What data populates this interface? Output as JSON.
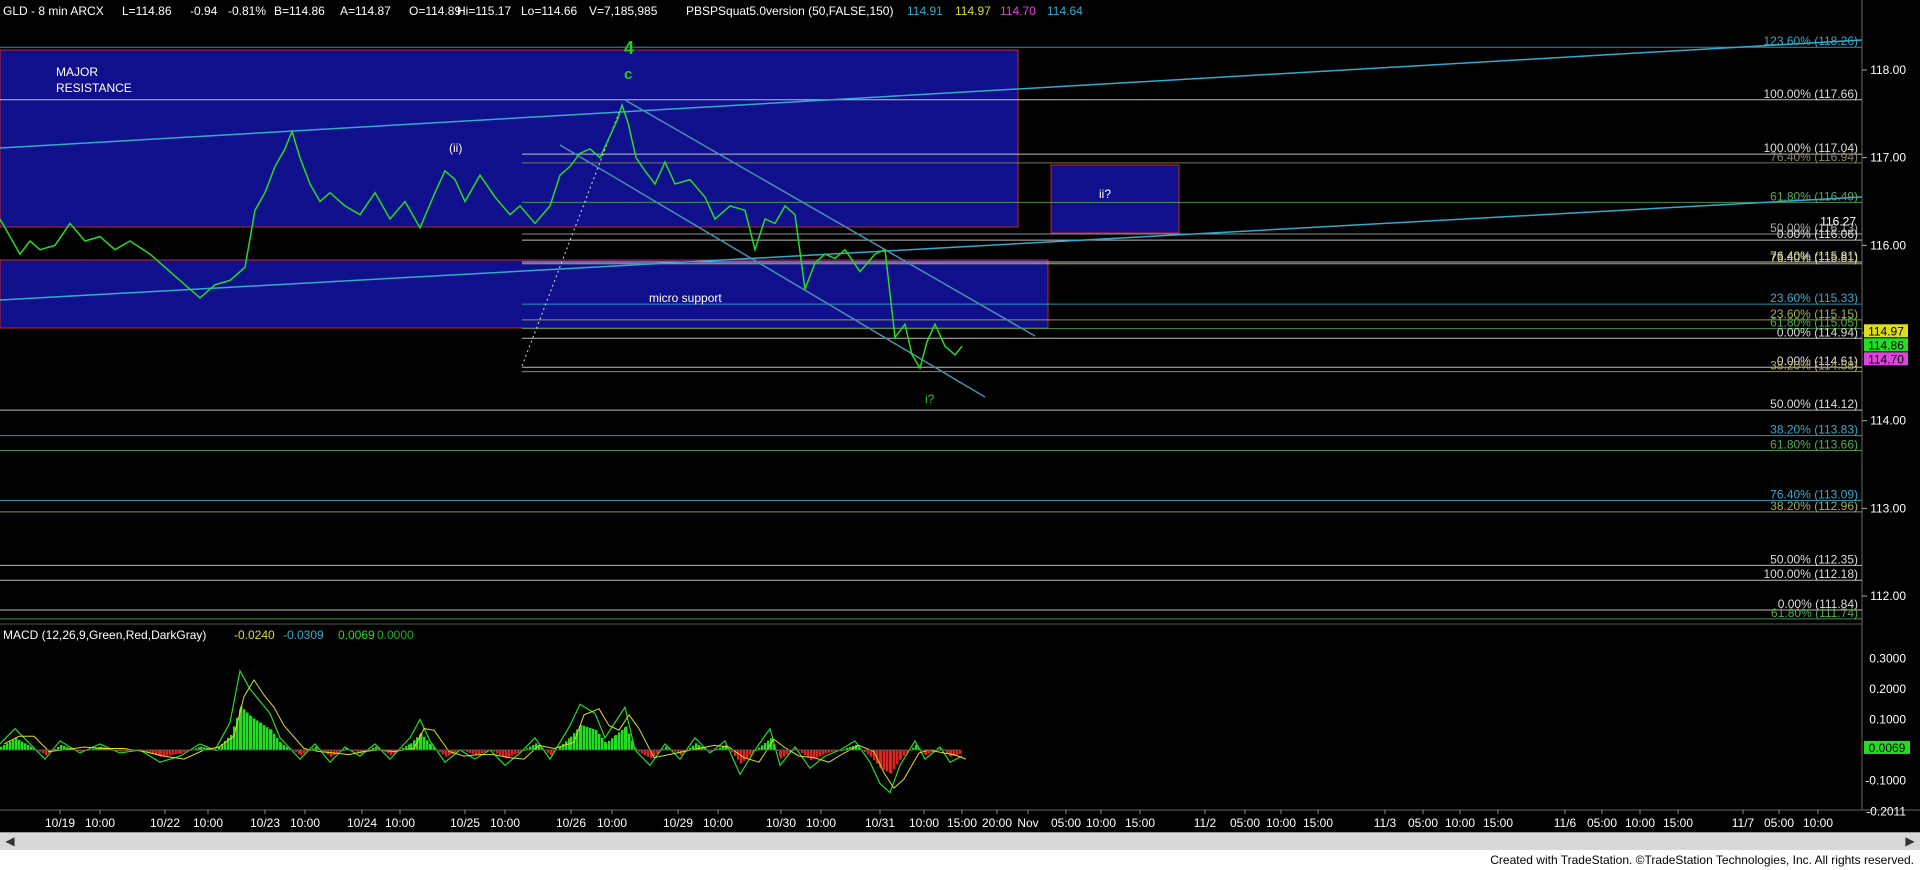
{
  "header": {
    "symbol": "GLD - 8 min  ARCX",
    "last": "L=114.86",
    "change": "-0.94",
    "pct": "-0.81%",
    "bid": "B=114.86",
    "ask": "A=114.87",
    "open": "O=114.89",
    "high": "Hi=115.17",
    "low": "Lo=114.66",
    "volume": "V=7,185,985",
    "study": "PBSPSquat5.0version (50,FALSE,150)",
    "v1": "114.91",
    "v2": "114.97",
    "v3": "114.70",
    "v4": "114.64"
  },
  "macd_header": {
    "name": "MACD (12,26,9,Green,Red,DarkGray)",
    "v1": "-0.0240",
    "v2": "-0.0309",
    "v3": "0.0069",
    "v4": "0.0000"
  },
  "colors": {
    "price": "#22dd22",
    "cyan": "#33aacc",
    "blue_box": "#10108c",
    "box_border": "#c02828",
    "green_label": "#22cc22",
    "yellow": "#dddd22",
    "magenta": "#dd44dd"
  },
  "annotations": {
    "major_resistance_1": "MAJOR",
    "major_resistance_2": "RESISTANCE",
    "micro_support": "micro support",
    "ii_box": "ii?",
    "wave4": "4",
    "wave_c": "c",
    "wave_ii_small": "(ii)",
    "wave_i": "i?"
  },
  "footer": {
    "credit": "Created with TradeStation. ©TradeStation Technologies, Inc. All rights reserved."
  },
  "chart_data": {
    "type": "line",
    "price_axis": {
      "ticks": [
        "118.00",
        "117.00",
        "116.00",
        "115.00",
        "114.00",
        "113.00",
        "112.00"
      ],
      "ylim": [
        111.6,
        118.6
      ]
    },
    "price_tags": [
      {
        "text": "116.27",
        "bg": "#000000",
        "fg": "#ffffff",
        "y": 116.27
      },
      {
        "text": "114.97",
        "bg": "#dddd22",
        "fg": "#000000",
        "y": 115.02
      },
      {
        "text": "114.86",
        "bg": "#22dd22",
        "fg": "#000000",
        "y": 114.86
      },
      {
        "text": "114.70",
        "bg": "#dd44dd",
        "fg": "#000000",
        "y": 114.7
      }
    ],
    "fib_levels": [
      {
        "text": "123.60% (118.26)",
        "y": 118.26,
        "color": "#33aacc"
      },
      {
        "text": "100.00% (117.66)",
        "y": 117.66,
        "color": "#dddddd"
      },
      {
        "text": "100.00% (117.04)",
        "y": 117.04,
        "color": "#dddddd"
      },
      {
        "text": "76.40% (116.94)",
        "y": 116.94,
        "color": "#888866"
      },
      {
        "text": "61.80% (116.49)",
        "y": 116.49,
        "color": "#55aa55"
      },
      {
        "text": "50.00% (116.13)",
        "y": 116.13,
        "color": "#aaaaaa"
      },
      {
        "text": "0.00% (116.06)",
        "y": 116.06,
        "color": "#dddddd"
      },
      {
        "text": "76.40% (115.81)",
        "y": 115.81,
        "color": "#dddddd"
      },
      {
        "text": "76.40% (115.81)",
        "y": 115.79,
        "color": "#cccc66"
      },
      {
        "text": "23.60% (115.33)",
        "y": 115.33,
        "color": "#33aacc"
      },
      {
        "text": "23.60% (115.15)",
        "y": 115.15,
        "color": "#aaaa55"
      },
      {
        "text": "61.80% (115.05)",
        "y": 115.05,
        "color": "#55aa55"
      },
      {
        "text": "0.00% (114.94)",
        "y": 114.94,
        "color": "#dddddd"
      },
      {
        "text": "0.00% (114.61)",
        "y": 114.61,
        "color": "#dddddd"
      },
      {
        "text": "38.20% (114.58)",
        "y": 114.56,
        "color": "#aaaa55"
      },
      {
        "text": "50.00% (114.12)",
        "y": 114.12,
        "color": "#dddddd"
      },
      {
        "text": "38.20% (113.83)",
        "y": 113.83,
        "color": "#33aacc"
      },
      {
        "text": "61.80% (113.66)",
        "y": 113.66,
        "color": "#55aa55"
      },
      {
        "text": "76.40% (113.09)",
        "y": 113.09,
        "color": "#33aacc"
      },
      {
        "text": "38.20% (112.96)",
        "y": 112.96,
        "color": "#aaaa55"
      },
      {
        "text": "50.00% (112.35)",
        "y": 112.35,
        "color": "#dddddd"
      },
      {
        "text": "100.00% (112.18)",
        "y": 112.18,
        "color": "#dddddd"
      },
      {
        "text": "0.00% (111.84)",
        "y": 111.84,
        "color": "#dddddd"
      },
      {
        "text": "61.80% (111.74)",
        "y": 111.74,
        "color": "#55aa55"
      }
    ],
    "macd_axis": {
      "ticks": [
        "0.3000",
        "0.2000",
        "0.1000",
        "-0.1000",
        "-0.2011"
      ],
      "current": "0.0069"
    },
    "x_labels": [
      "10/19",
      "10:00",
      "10/22",
      "10:00",
      "10/23",
      "10:00",
      "10/24",
      "10:00",
      "10/25",
      "10:00",
      "10/26",
      "10:00",
      "10/29",
      "10:00",
      "10/30",
      "10:00",
      "10/31",
      "10:00",
      "15:00",
      "20:00",
      "Nov",
      "05:00",
      "10:00",
      "15:00",
      "11/2",
      "05:00",
      "10:00",
      "15:00",
      "11/3",
      "05:00",
      "10:00",
      "15:00",
      "11/6",
      "05:00",
      "10:00",
      "15:00",
      "11/7",
      "05:00",
      "10:00"
    ],
    "price_path": [
      [
        0,
        116.3
      ],
      [
        10,
        116.1
      ],
      [
        20,
        115.9
      ],
      [
        30,
        116.05
      ],
      [
        40,
        115.95
      ],
      [
        55,
        116.0
      ],
      [
        70,
        116.25
      ],
      [
        85,
        116.05
      ],
      [
        100,
        116.1
      ],
      [
        115,
        115.95
      ],
      [
        130,
        116.05
      ],
      [
        150,
        115.9
      ],
      [
        165,
        115.75
      ],
      [
        180,
        115.6
      ],
      [
        200,
        115.4
      ],
      [
        215,
        115.55
      ],
      [
        230,
        115.6
      ],
      [
        245,
        115.75
      ],
      [
        255,
        116.4
      ],
      [
        265,
        116.6
      ],
      [
        275,
        116.9
      ],
      [
        285,
        117.1
      ],
      [
        292,
        117.3
      ],
      [
        300,
        117.0
      ],
      [
        310,
        116.7
      ],
      [
        320,
        116.5
      ],
      [
        330,
        116.6
      ],
      [
        345,
        116.45
      ],
      [
        360,
        116.35
      ],
      [
        375,
        116.6
      ],
      [
        390,
        116.3
      ],
      [
        405,
        116.5
      ],
      [
        420,
        116.2
      ],
      [
        435,
        116.6
      ],
      [
        445,
        116.85
      ],
      [
        455,
        116.75
      ],
      [
        465,
        116.5
      ],
      [
        480,
        116.8
      ],
      [
        495,
        116.55
      ],
      [
        510,
        116.35
      ],
      [
        520,
        116.45
      ],
      [
        535,
        116.25
      ],
      [
        550,
        116.45
      ],
      [
        560,
        116.8
      ],
      [
        570,
        116.9
      ],
      [
        580,
        117.05
      ],
      [
        590,
        117.1
      ],
      [
        600,
        117.0
      ],
      [
        610,
        117.25
      ],
      [
        618,
        117.45
      ],
      [
        622,
        117.6
      ],
      [
        628,
        117.4
      ],
      [
        636,
        117.0
      ],
      [
        645,
        116.85
      ],
      [
        655,
        116.7
      ],
      [
        665,
        116.95
      ],
      [
        675,
        116.7
      ],
      [
        690,
        116.75
      ],
      [
        705,
        116.55
      ],
      [
        715,
        116.3
      ],
      [
        730,
        116.45
      ],
      [
        745,
        116.4
      ],
      [
        755,
        115.95
      ],
      [
        765,
        116.3
      ],
      [
        775,
        116.25
      ],
      [
        785,
        116.45
      ],
      [
        795,
        116.35
      ],
      [
        805,
        115.5
      ],
      [
        815,
        115.8
      ],
      [
        825,
        115.9
      ],
      [
        835,
        115.85
      ],
      [
        845,
        115.95
      ],
      [
        860,
        115.7
      ],
      [
        875,
        115.9
      ],
      [
        885,
        115.95
      ],
      [
        895,
        114.95
      ],
      [
        905,
        115.1
      ],
      [
        912,
        114.75
      ],
      [
        920,
        114.6
      ],
      [
        927,
        114.9
      ],
      [
        935,
        115.1
      ],
      [
        945,
        114.85
      ],
      [
        955,
        114.75
      ],
      [
        962,
        114.85
      ]
    ],
    "macd_path": [
      [
        0,
        0.02
      ],
      [
        15,
        0.07
      ],
      [
        30,
        0.02
      ],
      [
        45,
        -0.03
      ],
      [
        60,
        0.03
      ],
      [
        80,
        -0.01
      ],
      [
        100,
        0.02
      ],
      [
        120,
        -0.01
      ],
      [
        140,
        0.0
      ],
      [
        160,
        -0.04
      ],
      [
        180,
        -0.02
      ],
      [
        200,
        0.02
      ],
      [
        215,
        0.0
      ],
      [
        230,
        0.09
      ],
      [
        240,
        0.26
      ],
      [
        250,
        0.2
      ],
      [
        260,
        0.16
      ],
      [
        270,
        0.12
      ],
      [
        280,
        0.04
      ],
      [
        300,
        -0.03
      ],
      [
        315,
        0.02
      ],
      [
        330,
        -0.04
      ],
      [
        345,
        0.01
      ],
      [
        360,
        -0.02
      ],
      [
        375,
        0.02
      ],
      [
        390,
        -0.03
      ],
      [
        410,
        0.04
      ],
      [
        420,
        0.1
      ],
      [
        430,
        0.03
      ],
      [
        445,
        -0.04
      ],
      [
        460,
        0.0
      ],
      [
        475,
        -0.03
      ],
      [
        490,
        0.0
      ],
      [
        505,
        -0.05
      ],
      [
        520,
        -0.01
      ],
      [
        535,
        0.04
      ],
      [
        550,
        -0.03
      ],
      [
        570,
        0.08
      ],
      [
        580,
        0.15
      ],
      [
        595,
        0.12
      ],
      [
        605,
        0.04
      ],
      [
        615,
        0.09
      ],
      [
        625,
        0.14
      ],
      [
        635,
        0.0
      ],
      [
        650,
        -0.05
      ],
      [
        665,
        0.02
      ],
      [
        680,
        -0.03
      ],
      [
        695,
        0.04
      ],
      [
        710,
        -0.01
      ],
      [
        725,
        0.03
      ],
      [
        740,
        -0.08
      ],
      [
        755,
        0.0
      ],
      [
        770,
        0.07
      ],
      [
        780,
        -0.05
      ],
      [
        795,
        0.01
      ],
      [
        810,
        -0.06
      ],
      [
        825,
        -0.02
      ],
      [
        840,
        0.0
      ],
      [
        855,
        0.03
      ],
      [
        870,
        -0.04
      ],
      [
        880,
        -0.11
      ],
      [
        890,
        -0.14
      ],
      [
        900,
        -0.05
      ],
      [
        915,
        0.03
      ],
      [
        925,
        -0.03
      ],
      [
        940,
        0.01
      ],
      [
        950,
        -0.04
      ],
      [
        962,
        -0.02
      ]
    ]
  }
}
